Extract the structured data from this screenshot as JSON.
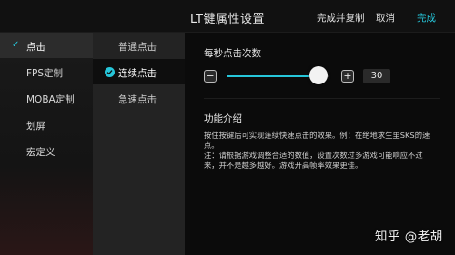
{
  "header": {
    "title": "LT键属性设置",
    "complete_copy_label": "完成并复制",
    "cancel_label": "取消",
    "done_label": "完成"
  },
  "categories": [
    {
      "label": "点击",
      "selected": true
    },
    {
      "label": "FPS定制",
      "selected": false
    },
    {
      "label": "MOBA定制",
      "selected": false
    },
    {
      "label": "划屏",
      "selected": false
    },
    {
      "label": "宏定义",
      "selected": false
    }
  ],
  "sub_options": [
    {
      "label": "普通点击",
      "selected": false
    },
    {
      "label": "连续点击",
      "selected": true
    },
    {
      "label": "急速点击",
      "selected": false
    }
  ],
  "setting": {
    "title": "每秒点击次数",
    "value": "30",
    "slider_fraction": 0.89
  },
  "intro": {
    "title": "功能介绍",
    "line1": "按住按键后可实现连续快速点击的效果。例：在绝地求生里SKS的速点。",
    "line2": "注：请根据游戏调整合适的数值，设置次数过多游戏可能响应不过来，并不是越多越好。游戏开高帧率效果更佳。"
  },
  "watermark": "知乎 @老胡",
  "colors": {
    "accent": "#26c6da"
  }
}
